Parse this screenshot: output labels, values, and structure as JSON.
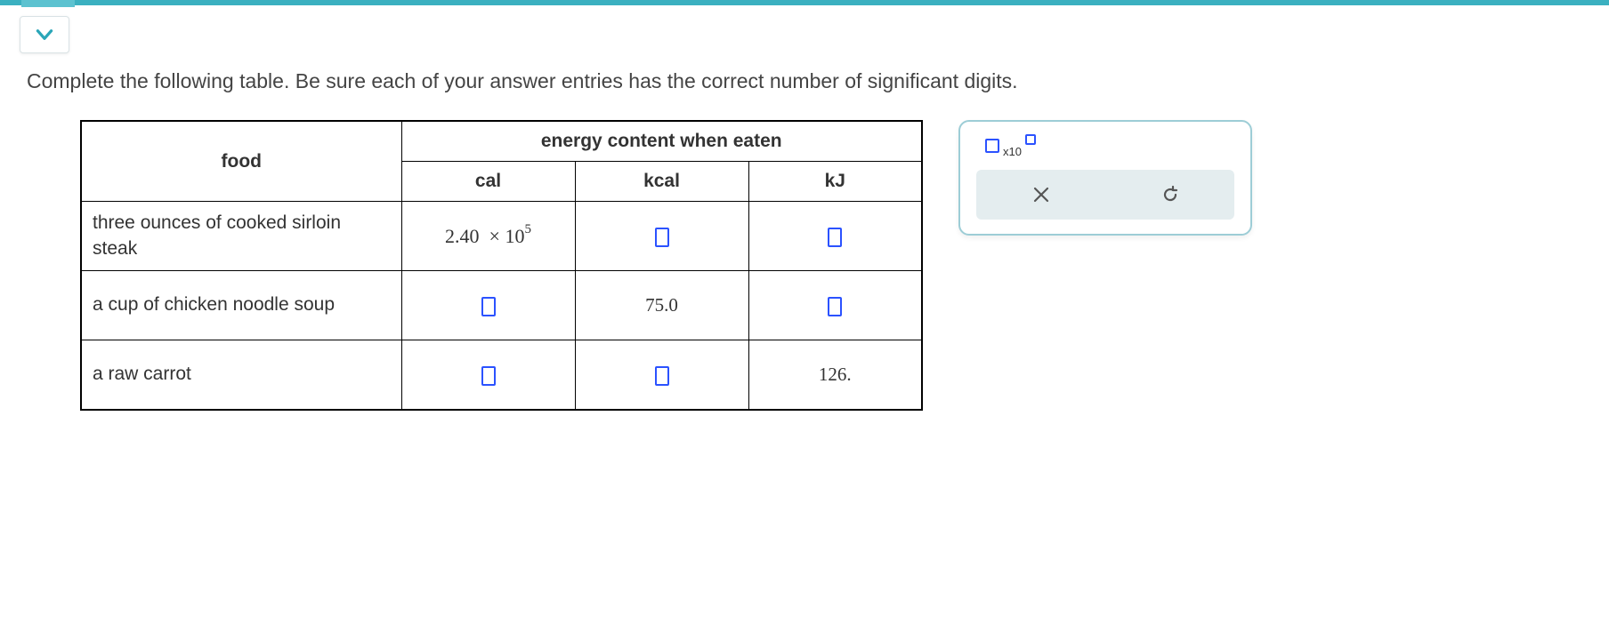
{
  "instruction": "Complete the following table. Be sure each of your answer entries has the correct number of significant digits.",
  "table": {
    "food_header": "food",
    "energy_header": "energy content when eaten",
    "columns": {
      "c1": "cal",
      "c2": "kcal",
      "c3": "kJ"
    },
    "rows": [
      {
        "food": "three ounces of cooked sirloin steak",
        "cal": {
          "type": "scientific",
          "coefficient": "2.40",
          "exponent": "5"
        },
        "kcal": {
          "type": "input"
        },
        "kJ": {
          "type": "input"
        }
      },
      {
        "food": "a cup of chicken noodle soup",
        "cal": {
          "type": "input"
        },
        "kcal": {
          "type": "value",
          "text": "75.0"
        },
        "kJ": {
          "type": "input"
        }
      },
      {
        "food": "a raw carrot",
        "cal": {
          "type": "input"
        },
        "kcal": {
          "type": "input"
        },
        "kJ": {
          "type": "value",
          "text": "126."
        }
      }
    ]
  },
  "tools": {
    "x10_label": "x10"
  }
}
